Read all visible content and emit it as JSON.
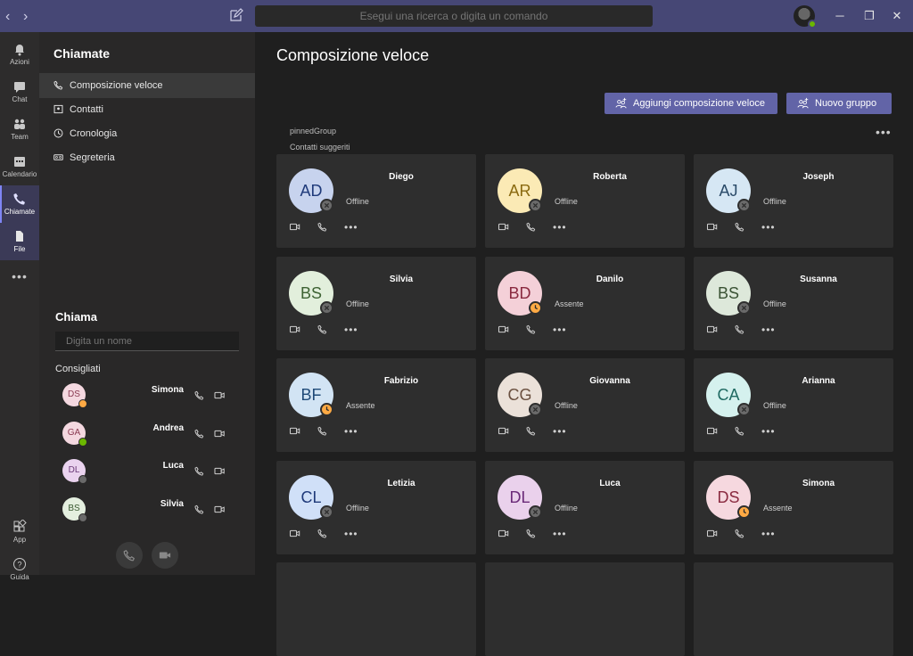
{
  "search": {
    "placeholder": "Esegui una ricerca o digita un comando"
  },
  "rail": [
    {
      "label": "Azioni",
      "icon": "bell-icon"
    },
    {
      "label": "Chat",
      "icon": "chat-icon"
    },
    {
      "label": "Team",
      "icon": "teams-icon"
    },
    {
      "label": "Calendario",
      "icon": "calendar-icon"
    },
    {
      "label": "Chiamate",
      "icon": "phone-icon"
    },
    {
      "label": "File",
      "icon": "file-icon"
    },
    {
      "label": "App",
      "icon": "apps-icon"
    },
    {
      "label": "Guida",
      "icon": "help-icon"
    }
  ],
  "sidebar": {
    "title": "Chiamate",
    "items": [
      {
        "label": "Composizione veloce"
      },
      {
        "label": "Contatti"
      },
      {
        "label": "Cronologia"
      },
      {
        "label": "Segreteria"
      }
    ],
    "call_title": "Chiama",
    "name_placeholder": "Digita un nome",
    "suggested_title": "Consigliati",
    "suggested": [
      {
        "initials": "DS",
        "name": "Simona",
        "status": "away",
        "color": "#f4d8e0",
        "text": "#8a3a52"
      },
      {
        "initials": "GA",
        "name": "Andrea",
        "status": "online",
        "color": "#f4d8e0",
        "text": "#8a3a52"
      },
      {
        "initials": "DL",
        "name": "Luca",
        "status": "offline",
        "color": "#ead3ef",
        "text": "#6b3a78"
      },
      {
        "initials": "BS",
        "name": "Silvia",
        "status": "offline",
        "color": "#e4efdf",
        "text": "#3a5a32"
      }
    ]
  },
  "main": {
    "title": "Composizione veloce",
    "add_button": "Aggiungi composizione veloce",
    "group_button": "Nuovo gruppo",
    "group_label": "pinnedGroup",
    "suggested_label": "Contatti suggeriti",
    "cards": [
      {
        "initials": "AD",
        "name": "Diego",
        "status_text": "Offline",
        "status": "offline",
        "color": "#c7d3ee",
        "text": "#1f3a7a"
      },
      {
        "initials": "AR",
        "name": "Roberta",
        "status_text": "Offline",
        "status": "offline",
        "color": "#fbeab5",
        "text": "#8a6a10"
      },
      {
        "initials": "AJ",
        "name": "Joseph",
        "status_text": "Offline",
        "status": "offline",
        "color": "#d6e7f4",
        "text": "#2a4a68"
      },
      {
        "initials": "BS",
        "name": "Silvia",
        "status_text": "Offline",
        "status": "offline",
        "color": "#e2efdc",
        "text": "#3d6233"
      },
      {
        "initials": "BD",
        "name": "Danilo",
        "status_text": "Assente",
        "status": "away",
        "color": "#f4d0d8",
        "text": "#8a2a40"
      },
      {
        "initials": "BS",
        "name": "Susanna",
        "status_text": "Offline",
        "status": "offline",
        "color": "#dde8da",
        "text": "#3a5234"
      },
      {
        "initials": "BF",
        "name": "Fabrizio",
        "status_text": "Assente",
        "status": "away",
        "color": "#d2e4f4",
        "text": "#1f4a78"
      },
      {
        "initials": "CG",
        "name": "Giovanna",
        "status_text": "Offline",
        "status": "offline",
        "color": "#ebe1d9",
        "text": "#6a5040"
      },
      {
        "initials": "CA",
        "name": "Arianna",
        "status_text": "Offline",
        "status": "offline",
        "color": "#d5f1ee",
        "text": "#1f6a62"
      },
      {
        "initials": "CL",
        "name": "Letizia",
        "status_text": "Offline",
        "status": "offline",
        "color": "#d0e0f8",
        "text": "#1f3a7a"
      },
      {
        "initials": "DL",
        "name": "Luca",
        "status_text": "Offline",
        "status": "offline",
        "color": "#ead1ec",
        "text": "#6a2a78"
      },
      {
        "initials": "DS",
        "name": "Simona",
        "status_text": "Assente",
        "status": "away",
        "color": "#f6d8df",
        "text": "#8a2a40"
      }
    ]
  },
  "colors": {
    "titlebar": "#464775",
    "accent": "#6264a7",
    "away": "#ffaa44",
    "online": "#6bb700",
    "offline": "#6a6a6a"
  }
}
